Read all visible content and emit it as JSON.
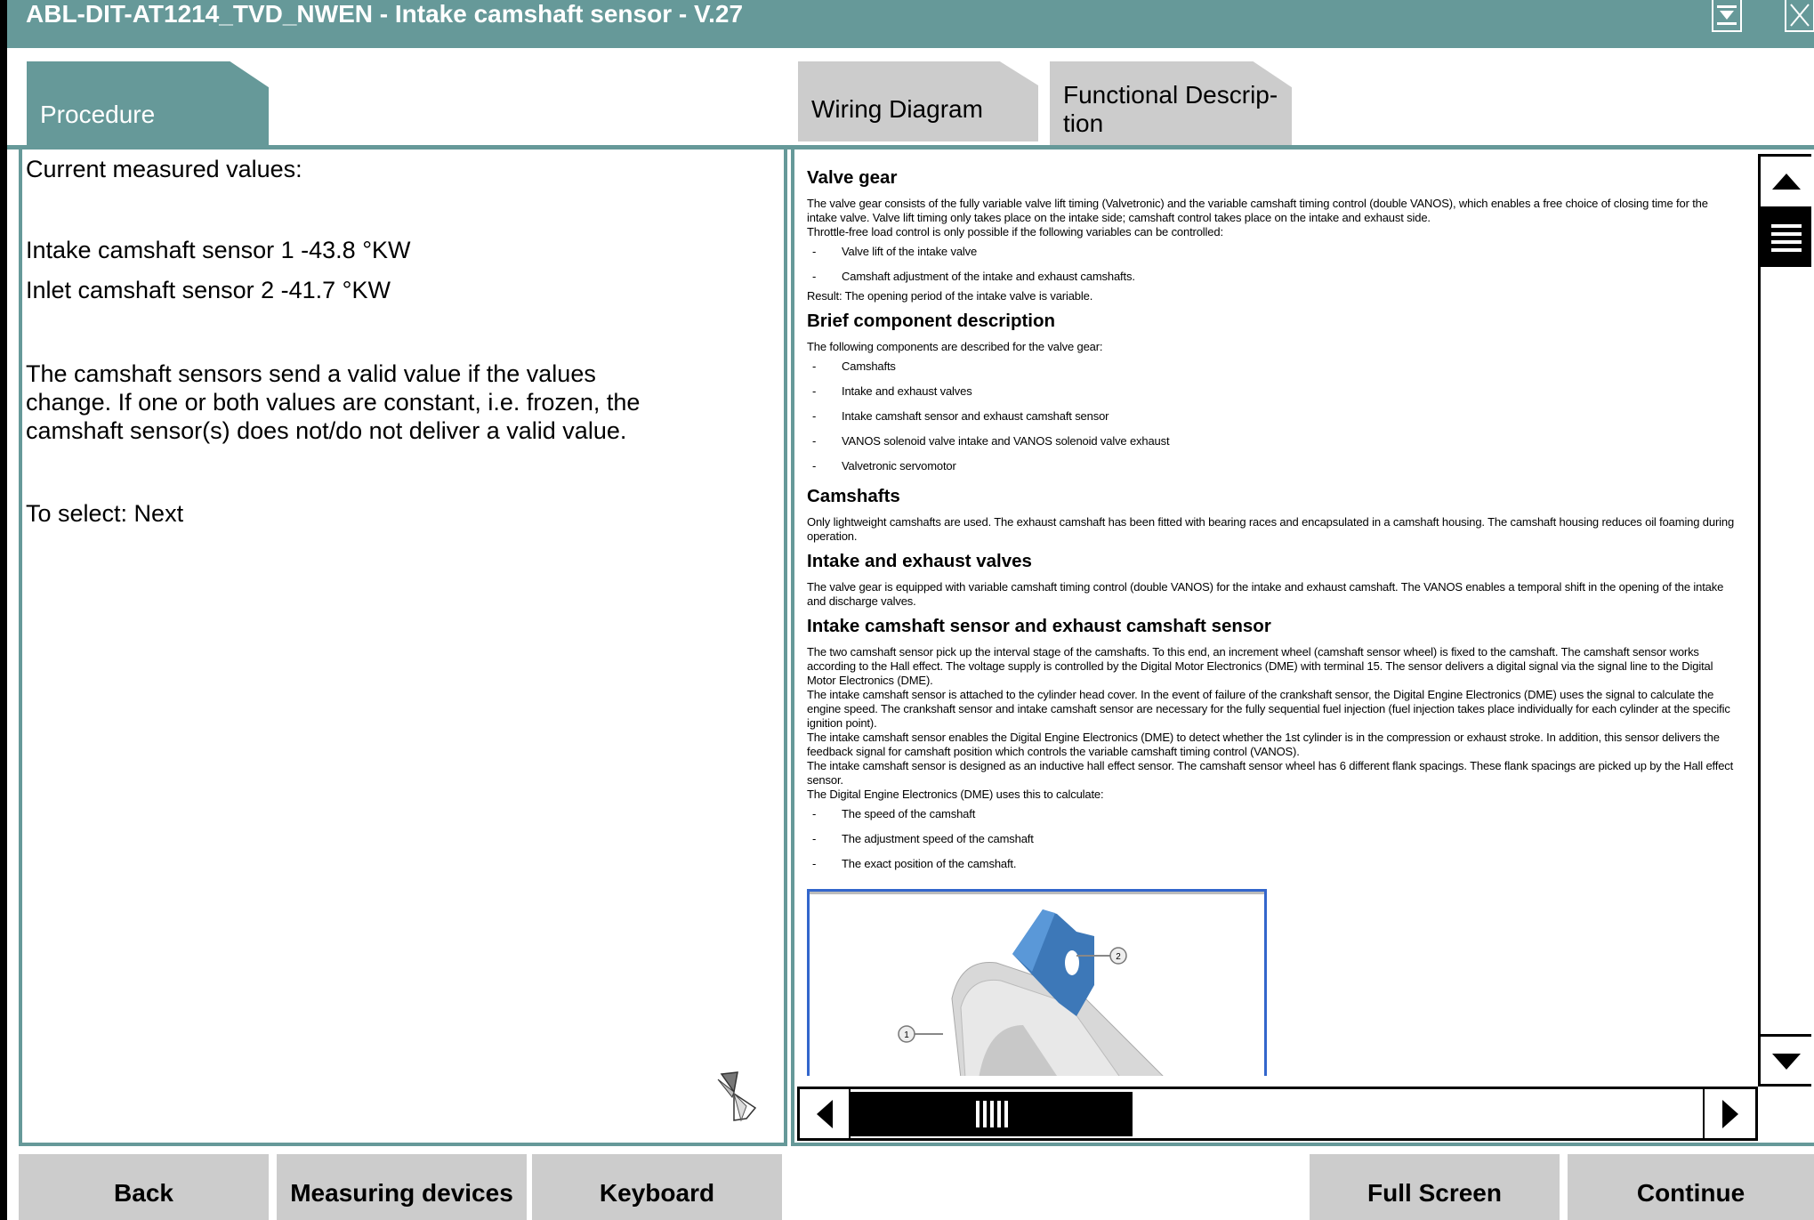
{
  "window": {
    "title": "ABL-DIT-AT1214_TVD_NWEN - Intake camshaft sensor - V.27",
    "minimize_icon": "minimize-dropdown-icon",
    "close_icon": "close-icon"
  },
  "tabs": [
    {
      "label": "Procedure",
      "active": true
    },
    {
      "label": "Wiring Diagram",
      "active": false
    },
    {
      "label": "Functional Descrip-",
      "label2": "tion",
      "active": false
    }
  ],
  "colors": {
    "accent": "#669999",
    "button": "#cccccc",
    "figure_border": "#3366cc"
  },
  "procedure": {
    "heading": "Current measured values:",
    "values": [
      "Intake camshaft sensor 1 -43.8 °KW",
      "Inlet camshaft sensor 2  -41.7 °KW"
    ],
    "note": [
      "The camshaft sensors send a valid value if the values",
      "change. If one or both values are constant, i.e. frozen, the",
      "camshaft sensor(s) does not/do not deliver a valid value."
    ],
    "instruction": "To select: Next",
    "busy_icon": "hourglass-spinner-icon"
  },
  "description": {
    "valve_gear": {
      "title": "Valve gear",
      "p1": "The valve gear consists of the fully variable valve lift timing (Valvetronic) and the variable camshaft timing control (double VANOS), which enables a free choice of closing time for the intake valve. Valve lift timing only takes place on the intake side; camshaft control takes place on the intake and exhaust side.",
      "p2": "Throttle-free load control is only possible if the following variables can be controlled:",
      "items": [
        "Valve lift of the intake valve",
        "Camshaft adjustment of the intake and exhaust camshafts."
      ],
      "result": "Result: The opening period of the intake valve is variable."
    },
    "brief": {
      "title": "Brief component description",
      "intro": "The following components are described for the valve gear:",
      "items": [
        "Camshafts",
        "Intake and exhaust valves",
        "Intake camshaft sensor and exhaust camshaft sensor",
        "VANOS solenoid valve intake and VANOS solenoid valve exhaust",
        "Valvetronic servomotor"
      ]
    },
    "camshafts": {
      "title": "Camshafts",
      "p": "Only lightweight camshafts are used. The exhaust camshaft has been fitted with bearing races and encapsulated in a camshaft housing. The camshaft housing reduces oil foaming during operation."
    },
    "valves": {
      "title": "Intake and exhaust valves",
      "p": "The valve gear is equipped with variable camshaft timing control (double VANOS) for the intake and exhaust camshaft. The VANOS enables a temporal shift in the opening of the intake and discharge valves."
    },
    "sensors": {
      "title": "Intake camshaft sensor and exhaust camshaft sensor",
      "p1": "The two camshaft sensor pick up the interval stage of the camshafts. To this end, an increment wheel (camshaft sensor wheel) is fixed to the camshaft. The camshaft sensor works according to the Hall effect. The voltage supply is controlled by the Digital Motor Electronics (DME) with terminal 15. The sensor delivers a digital signal via the signal line to the Digital Motor Electronics (DME).",
      "p2": "The intake camshaft sensor is attached to the cylinder head cover. In the event of failure of the crankshaft sensor, the Digital Engine Electronics (DME) uses the signal to calculate the engine speed. The crankshaft sensor and intake camshaft sensor are necessary for the fully sequential fuel injection (fuel injection takes place individually for each cylinder at the specific ignition point).",
      "p3": "The intake camshaft sensor enables the Digital Engine Electronics (DME) to detect whether the 1st cylinder is in the compression or exhaust stroke. In addition, this sensor delivers the feedback signal for camshaft position which controls the variable camshaft timing control (VANOS).",
      "p4": "The intake camshaft sensor is designed as an inductive hall effect sensor. The camshaft sensor wheel has 6 different flank spacings. These flank spacings are picked up by the Hall effect sensor.",
      "p5": "The Digital Engine Electronics (DME) uses this to calculate:",
      "items": [
        "The speed of the camshaft",
        "The adjustment speed of the camshaft",
        "The exact position of the camshaft."
      ]
    },
    "figure": {
      "callouts": [
        "1",
        "2"
      ]
    },
    "bullet": "-"
  },
  "buttons": {
    "back": "Back",
    "measuring": "Measuring devices",
    "keyboard": "Keyboard",
    "fullscreen": "Full Screen",
    "continue": "Continue"
  }
}
